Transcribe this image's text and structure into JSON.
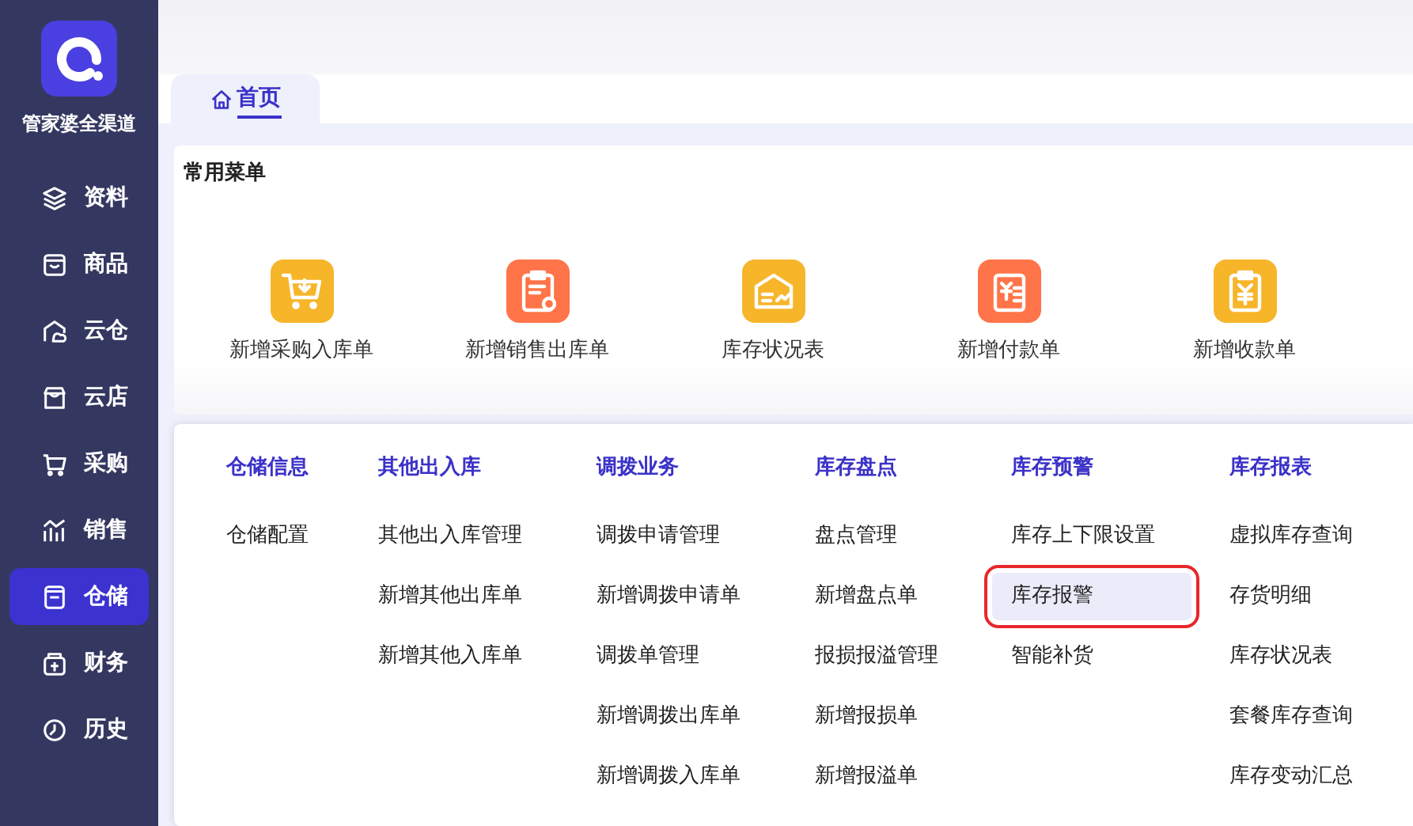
{
  "sidebar": {
    "brand": "管家婆全渠道",
    "items": [
      {
        "label": "资料",
        "selected": false
      },
      {
        "label": "商品",
        "selected": false
      },
      {
        "label": "云仓",
        "selected": false
      },
      {
        "label": "云店",
        "selected": false
      },
      {
        "label": "采购",
        "selected": false
      },
      {
        "label": "销售",
        "selected": false
      },
      {
        "label": "仓储",
        "selected": true
      },
      {
        "label": "财务",
        "selected": false
      },
      {
        "label": "历史",
        "selected": false
      }
    ]
  },
  "tabs": [
    {
      "label": "首页",
      "selected": true
    }
  ],
  "favorites": {
    "title": "常用菜单",
    "items": [
      {
        "label": "新增采购入库单",
        "color": "#f7b52a"
      },
      {
        "label": "新增销售出库单",
        "color": "#ff7448"
      },
      {
        "label": "库存状况表",
        "color": "#f7b52a"
      },
      {
        "label": "新增付款单",
        "color": "#ff7448"
      },
      {
        "label": "新增收款单",
        "color": "#f7b52a"
      }
    ]
  },
  "menu": {
    "columns": [
      {
        "title": "仓储信息",
        "items": [
          {
            "label": "仓储配置",
            "selected": false
          }
        ]
      },
      {
        "title": "其他出入库",
        "items": [
          {
            "label": "其他出入库管理",
            "selected": false
          },
          {
            "label": "新增其他出库单",
            "selected": false
          },
          {
            "label": "新增其他入库单",
            "selected": false
          }
        ]
      },
      {
        "title": "调拨业务",
        "items": [
          {
            "label": "调拨申请管理",
            "selected": false
          },
          {
            "label": "新增调拨申请单",
            "selected": false
          },
          {
            "label": "调拨单管理",
            "selected": false
          },
          {
            "label": "新增调拨出库单",
            "selected": false
          },
          {
            "label": "新增调拨入库单",
            "selected": false
          }
        ]
      },
      {
        "title": "库存盘点",
        "items": [
          {
            "label": "盘点管理",
            "selected": false
          },
          {
            "label": "新增盘点单",
            "selected": false
          },
          {
            "label": "报损报溢管理",
            "selected": false
          },
          {
            "label": "新增报损单",
            "selected": false
          },
          {
            "label": "新增报溢单",
            "selected": false
          }
        ]
      },
      {
        "title": "库存预警",
        "items": [
          {
            "label": "库存上下限设置",
            "selected": false
          },
          {
            "label": "库存报警",
            "selected": true
          },
          {
            "label": "智能补货",
            "selected": false
          }
        ]
      },
      {
        "title": "库存报表",
        "items": [
          {
            "label": "虚拟库存查询",
            "selected": false
          },
          {
            "label": "存货明细",
            "selected": false
          },
          {
            "label": "库存状况表",
            "selected": false
          },
          {
            "label": "套餐库存查询",
            "selected": false
          },
          {
            "label": "库存变动汇总",
            "selected": false
          }
        ]
      }
    ]
  }
}
